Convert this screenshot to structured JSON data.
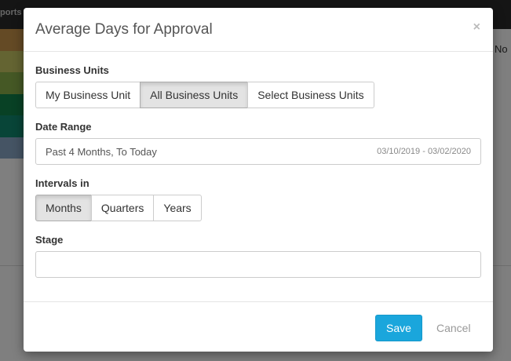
{
  "background": {
    "topbar_text": "ports",
    "right_text": "No",
    "stripe_colors": [
      "#c9954a",
      "#c8c865",
      "#8ab04a",
      "#11834a",
      "#118a70",
      "#8aa8c8"
    ]
  },
  "modal": {
    "title": "Average Days for Approval",
    "close_glyph": "×",
    "business_units": {
      "label": "Business Units",
      "options": [
        "My Business Unit",
        "All Business Units",
        "Select Business Units"
      ],
      "selected": "All Business Units"
    },
    "date_range": {
      "label": "Date Range",
      "value": "Past 4 Months, To Today",
      "dates": "03/10/2019 - 03/02/2020"
    },
    "intervals": {
      "label": "Intervals in",
      "options": [
        "Months",
        "Quarters",
        "Years"
      ],
      "selected": "Months"
    },
    "stage": {
      "label": "Stage",
      "value": ""
    },
    "footer": {
      "save_label": "Save",
      "cancel_label": "Cancel"
    }
  },
  "colors": {
    "primary": "#1aa6dc"
  }
}
